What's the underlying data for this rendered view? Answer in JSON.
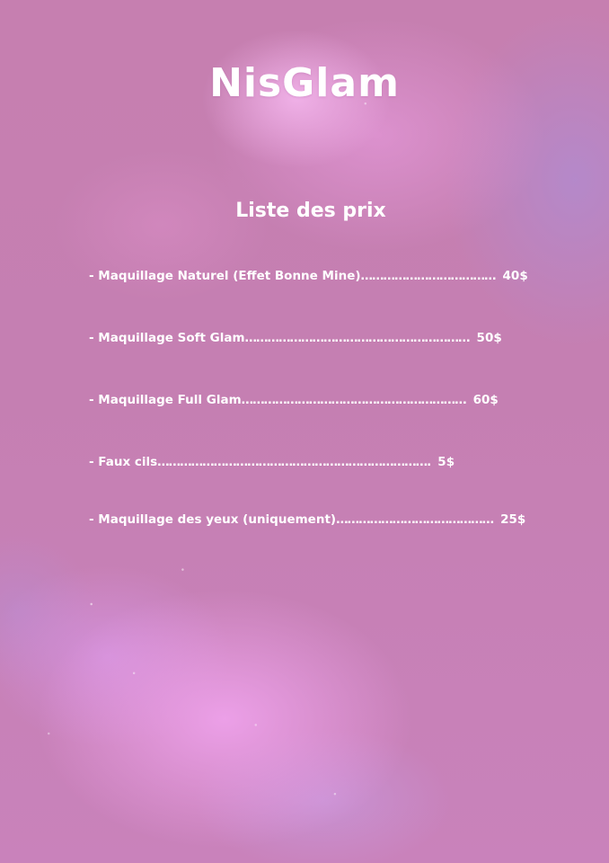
{
  "brand": "NisGlam",
  "subtitle": "Liste des prix",
  "items": [
    {
      "label": "- Maquillage Naturel (Effet Bonne Mine)",
      "dots": "………………………………",
      "price": "40$"
    },
    {
      "label": "- Maquillage Soft Glam",
      "dots": "……………………………………………………",
      "price": "50$"
    },
    {
      "label": "- Maquillage Full Glam",
      "dots": "……………………………………………………",
      "price": "60$"
    },
    {
      "label": "- Faux cils",
      "dots": "……………………………………………………………….",
      "price": "5$"
    },
    {
      "label": "- Maquillage des yeux (uniquement)",
      "dots": "……………………………………",
      "price": "25$"
    }
  ],
  "colors": {
    "background": "#c67fb0",
    "nebula": "#f2a5f0",
    "text": "#ffffff"
  }
}
